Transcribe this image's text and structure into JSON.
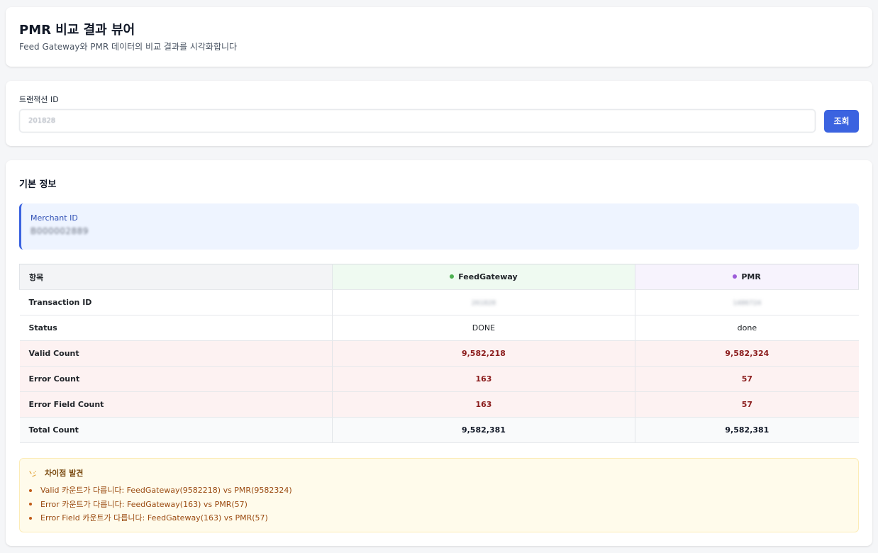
{
  "header": {
    "title": "PMR 비교 결과 뷰어",
    "subtitle": "Feed Gateway와 PMR 데이터의 비교 결과를 시각화합니다"
  },
  "search": {
    "label": "트랜잭션 ID",
    "value": "201828",
    "button_label": "조회"
  },
  "info": {
    "section_title": "기본 정보",
    "merchant_label": "Merchant ID",
    "merchant_value": "B000002889"
  },
  "table": {
    "headers": [
      "항목",
      "FeedGateway",
      "PMR"
    ],
    "rows": [
      {
        "label": "Transaction ID",
        "fg": "261828",
        "pmr": "1486724"
      },
      {
        "label": "Status",
        "fg": "DONE",
        "pmr": "done"
      },
      {
        "label": "Valid Count",
        "fg": "9,582,218",
        "pmr": "9,582,324"
      },
      {
        "label": "Error Count",
        "fg": "163",
        "pmr": "57"
      },
      {
        "label": "Error Field Count",
        "fg": "163",
        "pmr": "57"
      },
      {
        "label": "Total Count",
        "fg": "9,582,381",
        "pmr": "9,582,381"
      }
    ]
  },
  "differences": {
    "title": "차이점 발견",
    "items": [
      "Valid 카운트가 다릅니다: FeedGateway(9582218) vs PMR(9582324)",
      "Error 카운트가 다릅니다: FeedGateway(163) vs PMR(57)",
      "Error Field 카운트가 다릅니다: FeedGateway(163) vs PMR(57)"
    ]
  },
  "colors": {
    "accent": "#3b63e0",
    "feedgateway_dot": "#4caf50",
    "pmr_dot": "#9c5bd9",
    "diff_row_bg": "#fdf2f2",
    "warning_bg": "#fffbeb"
  }
}
